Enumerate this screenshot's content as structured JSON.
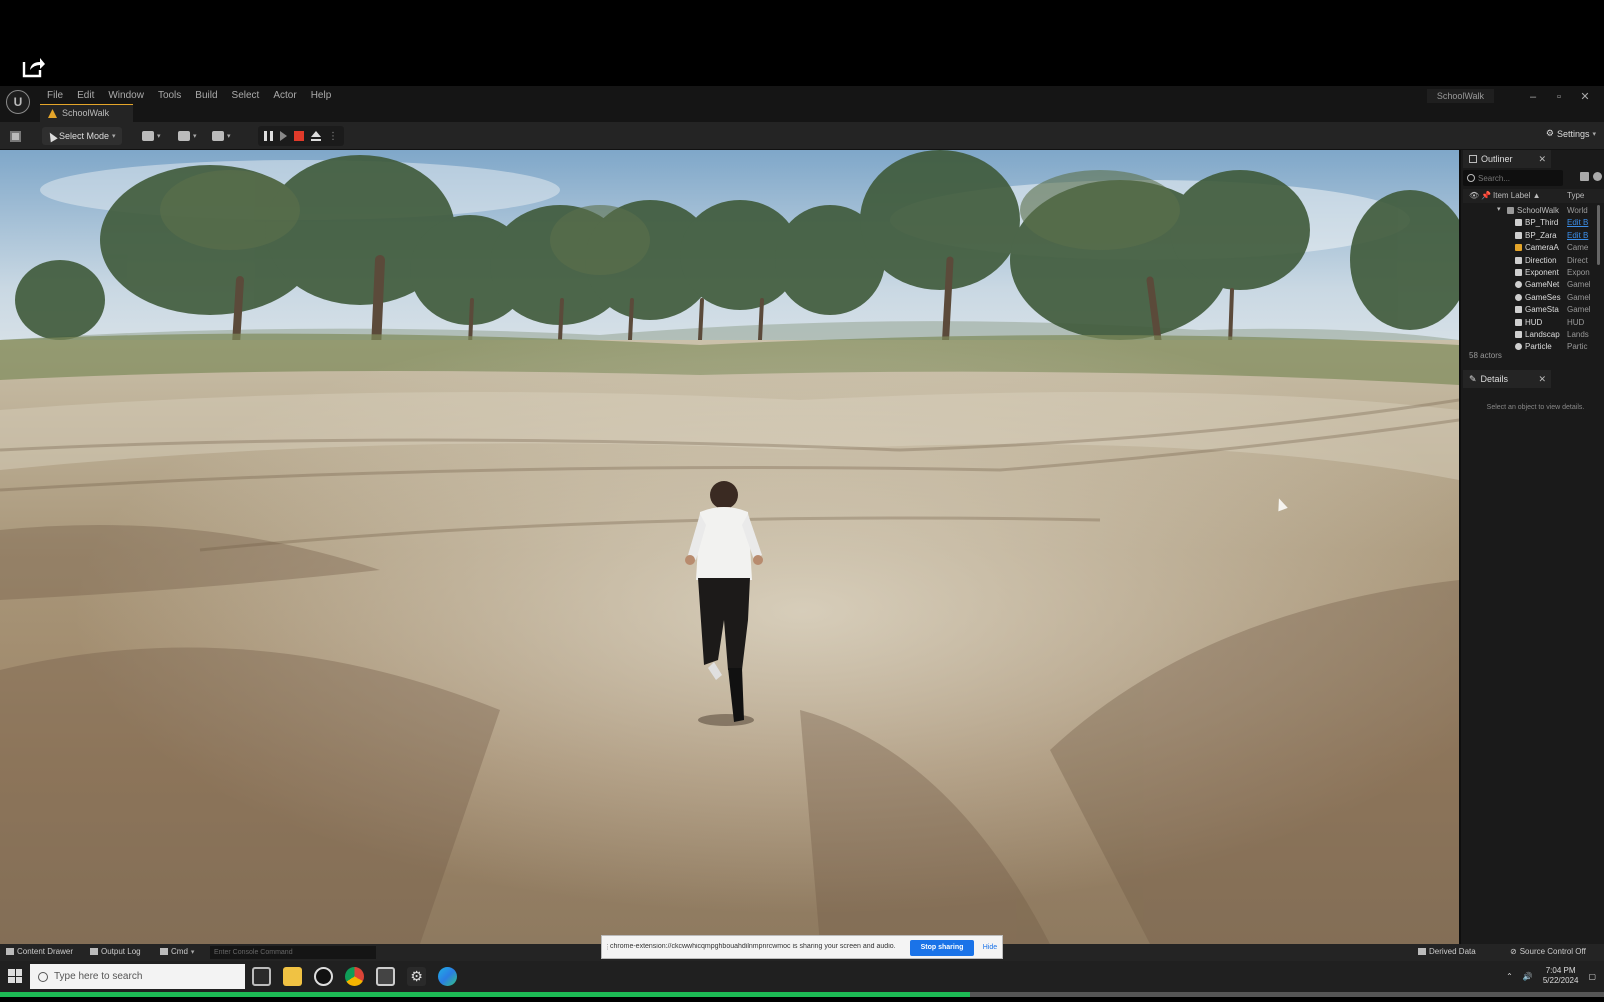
{
  "editor": {
    "logo": "U",
    "menu": [
      "File",
      "Edit",
      "Window",
      "Tools",
      "Build",
      "Select",
      "Actor",
      "Help"
    ],
    "level_tab": "SchoolWalk",
    "project_name": "SchoolWalk",
    "window_controls": [
      "–",
      "▫",
      "✕"
    ]
  },
  "toolbar": {
    "mode_label": "Select Mode",
    "settings_label": "Settings"
  },
  "outliner": {
    "tab_label": "Outliner",
    "search_placeholder": "Search...",
    "col_label": "Item Label ▲",
    "col_type": "Type",
    "root": {
      "label": "SchoolWalk",
      "type": "World"
    },
    "rows": [
      {
        "label": "BP_Third",
        "type": "Edit B",
        "link": true
      },
      {
        "label": "BP_Zara",
        "type": "Edit B",
        "link": true
      },
      {
        "label": "CameraA",
        "type": "Came",
        "link": false
      },
      {
        "label": "Direction",
        "type": "Direct",
        "link": false
      },
      {
        "label": "Exponent",
        "type": "Expon",
        "link": false
      },
      {
        "label": "GameNet",
        "type": "Gamel",
        "link": false
      },
      {
        "label": "GameSes",
        "type": "Gamel",
        "link": false
      },
      {
        "label": "GameSta",
        "type": "Gamel",
        "link": false
      },
      {
        "label": "HUD",
        "type": "HUD",
        "link": false
      },
      {
        "label": "Landscap",
        "type": "Lands",
        "link": false
      },
      {
        "label": "Particle",
        "type": "Partic",
        "link": false
      }
    ],
    "count": "58 actors"
  },
  "details": {
    "tab_label": "Details",
    "empty_text": "Select an object to view details."
  },
  "bottom_bar": {
    "content_drawer": "Content Drawer",
    "output_log": "Output Log",
    "cmd": "Cmd",
    "console_placeholder": "Enter Console Command",
    "derived_data": "Derived Data",
    "source_control": "Source Control Off"
  },
  "share_banner": {
    "text": "chrome-extension://ckcwwhicqmpghbouahdilnmpnrcwmoc is sharing your screen and audio.",
    "stop_label": "Stop sharing",
    "hide_label": "Hide"
  },
  "taskbar": {
    "search_placeholder": "Type here to search",
    "time": "7:04 PM",
    "date": "5/22/2024"
  },
  "progress": {
    "fraction": 0.605
  },
  "colors": {
    "accent_blue": "#1a73e8",
    "stop_red": "#e03a2a",
    "progress_green": "#1db954",
    "tab_orange": "#e4a52a"
  }
}
